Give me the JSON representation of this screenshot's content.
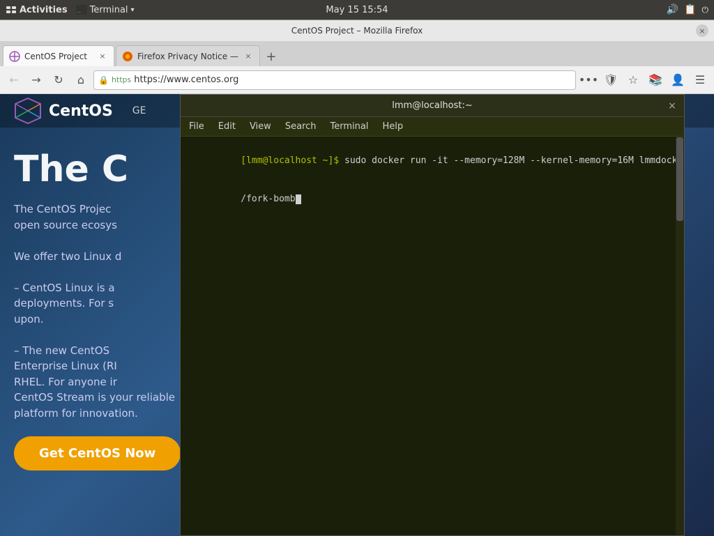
{
  "system_bar": {
    "activities": "Activities",
    "terminal_app": "Terminal",
    "datetime": "May 15  15:54"
  },
  "firefox": {
    "title": "CentOS Project – Mozilla Firefox",
    "tabs": [
      {
        "id": "tab1",
        "label": "CentOS Project",
        "active": true,
        "icon": "centos"
      },
      {
        "id": "tab2",
        "label": "Firefox Privacy Notice —",
        "active": false,
        "icon": "firefox"
      }
    ],
    "new_tab_label": "+",
    "url": "https://www.centos.org",
    "back_btn": "←",
    "forward_btn": "→",
    "refresh_btn": "↻",
    "home_btn": "⌂"
  },
  "centos_site": {
    "logo_text": "CentOS",
    "nav_item": "GE",
    "hero_title": "The C",
    "desc_line1": "The CentOS Projec",
    "desc_line2": "open source ecosys",
    "desc_line3": "",
    "desc_offer": "We offer two Linux d",
    "desc_linux1": "– CentOS Linux is a",
    "desc_linux1b": "deployments. For s",
    "desc_linux1c": "upon.",
    "desc_stream1": "– The new CentOS",
    "desc_stream2": "Enterprise Linux (RI",
    "desc_stream3": "RHEL. For anyone ir",
    "desc_stream4": "CentOS Stream is your reliable platform for innovation.",
    "cta_button": "Get CentOS Now"
  },
  "terminal": {
    "title": "lmm@localhost:~",
    "close_btn": "×",
    "menu": {
      "file": "File",
      "edit": "Edit",
      "view": "View",
      "search": "Search",
      "terminal": "Terminal",
      "help": "Help"
    },
    "command_line": "[lmm@localhost ~]$ sudo docker run -it --memory=128M --kernel-memory=16M lmmdock/fork-bomb",
    "cursor": ""
  }
}
